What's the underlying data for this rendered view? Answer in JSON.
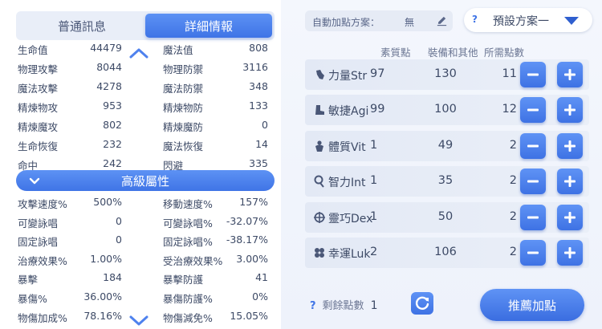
{
  "tabs": [
    {
      "label": "普通訊息",
      "active": false
    },
    {
      "label": "詳細情報",
      "active": true
    }
  ],
  "basic_stats": [
    {
      "l1": "生命值",
      "v1": "44479",
      "l2": "魔法值",
      "v2": "808"
    },
    {
      "l1": "物理攻擊",
      "v1": "8044",
      "l2": "物理防禦",
      "v2": "3116"
    },
    {
      "l1": "魔法攻擊",
      "v1": "4278",
      "l2": "魔法防禦",
      "v2": "348"
    },
    {
      "l1": "精煉物攻",
      "v1": "953",
      "l2": "精煉物防",
      "v2": "133"
    },
    {
      "l1": "精煉魔攻",
      "v1": "802",
      "l2": "精煉魔防",
      "v2": "0"
    },
    {
      "l1": "生命恢復",
      "v1": "232",
      "l2": "魔法恢復",
      "v2": "14"
    },
    {
      "l1": "命中",
      "v1": "242",
      "l2": "閃避",
      "v2": "335"
    }
  ],
  "advanced_header": "高級屬性",
  "advanced_stats": [
    {
      "l1": "攻擊速度%",
      "v1": "500%",
      "l2": "移動速度%",
      "v2": "157%"
    },
    {
      "l1": "可變詠唱",
      "v1": "0",
      "l2": "可變詠唱%",
      "v2": "-32.07%"
    },
    {
      "l1": "固定詠唱",
      "v1": "0",
      "l2": "固定詠唱%",
      "v2": "-38.17%"
    },
    {
      "l1": "治療效果%",
      "v1": "1.00%",
      "l2": "受治療效果%",
      "v2": "3.00%"
    },
    {
      "l1": "暴擊",
      "v1": "184",
      "l2": "暴擊防護",
      "v2": "41"
    },
    {
      "l1": "暴傷%",
      "v1": "36.00%",
      "l2": "暴傷防護%",
      "v2": "0%"
    },
    {
      "l1": "物傷加成%",
      "v1": "78.16%",
      "l2": "物傷減免%",
      "v2": "15.05%"
    }
  ],
  "auto_plan": {
    "label": "自動加點方案：",
    "value": "無"
  },
  "preset": {
    "help": "?",
    "name": "預設方案一"
  },
  "columns": {
    "base": "素質點",
    "equip": "裝備和其他",
    "need": "所需點數"
  },
  "attributes": [
    {
      "name": "力量Str",
      "base": "97",
      "equip": "130",
      "need": "11",
      "icon": "fist-icon"
    },
    {
      "name": "敏捷Agi",
      "base": "99",
      "equip": "100",
      "need": "12",
      "icon": "boot-icon"
    },
    {
      "name": "體質Vit",
      "base": "1",
      "equip": "49",
      "need": "2",
      "icon": "body-icon"
    },
    {
      "name": "智力Int",
      "base": "1",
      "equip": "35",
      "need": "2",
      "icon": "brain-icon"
    },
    {
      "name": "靈巧Dex",
      "base": "1",
      "equip": "50",
      "need": "2",
      "icon": "crosshair-icon"
    },
    {
      "name": "幸運Luk",
      "base": "2",
      "equip": "106",
      "need": "2",
      "icon": "clover-icon"
    }
  ],
  "remaining": {
    "help": "?",
    "label": "剩餘點數",
    "value": "1"
  },
  "recommend_label": "推薦加點",
  "colors": {
    "accent": "#3f74e6",
    "row_bg": "#e3e9f5"
  }
}
